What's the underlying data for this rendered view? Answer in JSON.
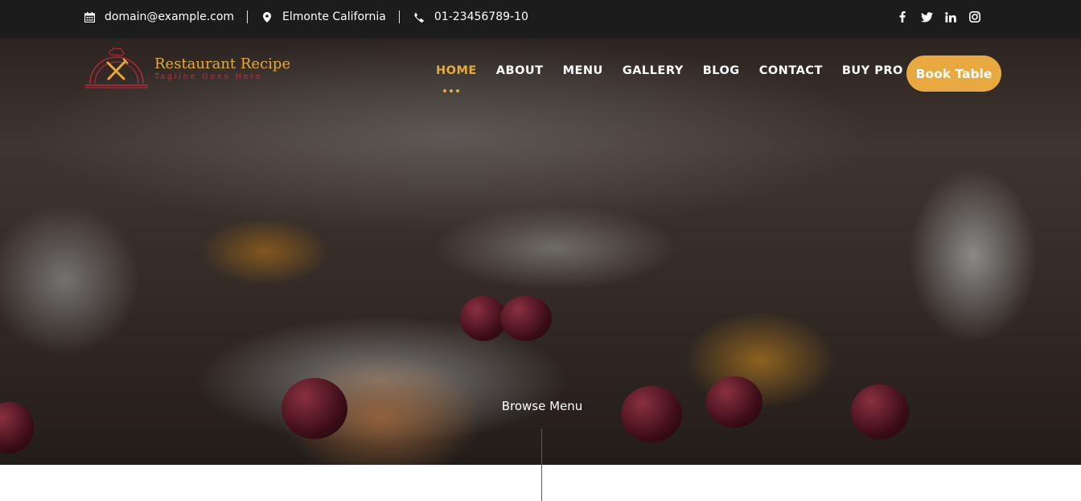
{
  "topbar": {
    "email": "domain@example.com",
    "location": "Elmonte California",
    "phone": "01-23456789-10",
    "icons": {
      "email": "calendar-icon",
      "location": "map-pin-icon",
      "phone": "phone-icon"
    },
    "social": [
      {
        "name": "facebook",
        "icon": "facebook-icon",
        "glyph": "f"
      },
      {
        "name": "twitter",
        "icon": "twitter-icon"
      },
      {
        "name": "linkedin",
        "icon": "linkedin-icon",
        "glyph": "in"
      },
      {
        "name": "instagram",
        "icon": "instagram-icon"
      }
    ]
  },
  "header": {
    "logo_title": "Restaurant Recipe",
    "logo_tagline": "Tagline Goes Here",
    "nav": [
      {
        "label": "HOME",
        "active": true
      },
      {
        "label": "ABOUT",
        "active": false
      },
      {
        "label": "MENU",
        "active": false
      },
      {
        "label": "GALLERY",
        "active": false
      },
      {
        "label": "BLOG",
        "active": false
      },
      {
        "label": "CONTACT",
        "active": false
      },
      {
        "label": "BUY PRO",
        "active": false
      }
    ],
    "cta_label": "Book Table"
  },
  "hero": {
    "browse_label": "Browse Menu"
  },
  "colors": {
    "accent": "#e8a93a",
    "brand_red": "#c8283c",
    "topbar_bg": "#1c1c1c"
  }
}
